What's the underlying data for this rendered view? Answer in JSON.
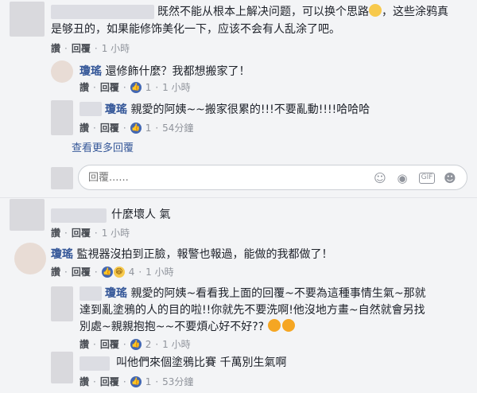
{
  "comment1": {
    "text_line1": "既然不能从根本上解决问题，可以换个思路",
    "text_line1_end": "，这些涂鸦真",
    "text_line2": "是够丑的，如果能修饰美化一下，应该不会有人乱涂了吧。",
    "reply": "讚",
    "reply2": "回覆",
    "time": "1 小時"
  },
  "reply1": {
    "name": "瓊瑤",
    "text": "還修飾什麼？我都想搬家了！",
    "reply": "讚",
    "reply2": "回覆",
    "likes": "1",
    "time": "1 小時"
  },
  "reply2": {
    "name": "瓊瑤",
    "text": "親愛的阿姨~~搬家很累的!!!不要亂動!!!!哈哈哈",
    "reply": "讚",
    "reply2": "回覆",
    "likes": "1",
    "time": "54分鐘"
  },
  "more_replies": "查看更多回覆",
  "reply_input": {
    "placeholder": "回覆......"
  },
  "comment2": {
    "text": "什麼壞人 氣",
    "reply": "讚",
    "reply2": "回覆",
    "time": "1 小時"
  },
  "comment3": {
    "name": "瓊瑤",
    "text": "監視器沒拍到正臉，報警也報過，能做的我都做了！",
    "reply": "讚",
    "reply2": "回覆",
    "likes": "4",
    "time": "1 小時"
  },
  "reply3": {
    "name": "瓊瑤",
    "text_line1": "親愛的阿姨~看看我上面的回覆~不要為這種事情生氣~那就",
    "text_line2": "達到亂塗鴉的人的目的啦!!你就先不要洗啊!他沒地方畫~自然就會另找",
    "text_line3": "別處~親親抱抱~~不要煩心好不好??",
    "reply": "讚",
    "reply2": "回覆",
    "likes": "2",
    "time": "1 小時"
  },
  "reply4": {
    "text": "叫他們來個塗鴉比賽 千萬別生氣啊",
    "reply": "讚",
    "reply2": "回覆",
    "likes": "1",
    "time": "53分鐘"
  },
  "colors": {
    "link": "#365899",
    "meta": "#90949c",
    "like": "#4267b2"
  }
}
